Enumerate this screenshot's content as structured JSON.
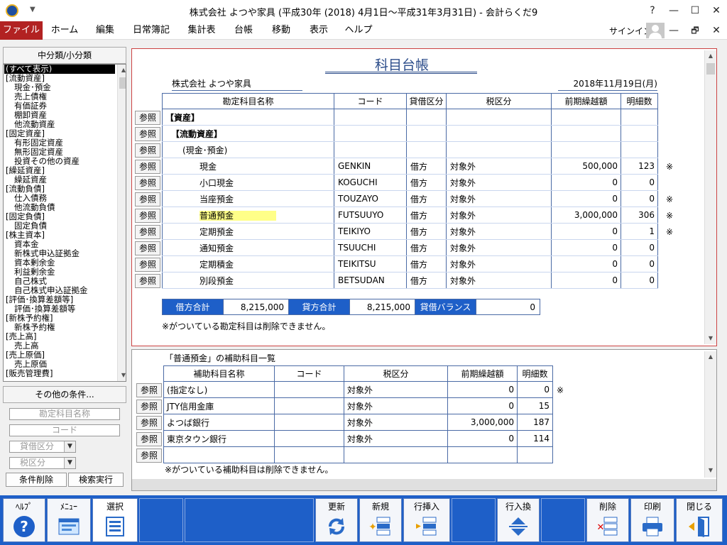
{
  "window": {
    "title": "株式会社 よつや家具 (平成30年 (2018) 4月1日～平成31年3月31日) - 会計らくだ9",
    "help": "?",
    "minimize": "—",
    "maximize": "☐",
    "close": "✕",
    "ribbon_min": "—",
    "ribbon_restore": "🗗",
    "ribbon_close": "✕"
  },
  "menu": {
    "items": [
      "ファイル",
      "ホーム",
      "編集",
      "日常簿記",
      "集計表",
      "台帳",
      "移動",
      "表示",
      "ヘルプ"
    ],
    "signin": "サインイン"
  },
  "left": {
    "header": "中分類/小分類",
    "categories": [
      "(すべて表示)",
      "[流動資産]",
      "現金･預金",
      "売上債権",
      "有価証券",
      "棚卸資産",
      "他流動資産",
      "[固定資産]",
      "有形固定資産",
      "無形固定資産",
      "投資その他の資産",
      "[繰延資産]",
      "繰延資産",
      "[流動負債]",
      "仕入債務",
      "他流動負債",
      "[固定負債]",
      "固定負債",
      "[株主資本]",
      "資本金",
      "新株式申込証拠金",
      "資本剰余金",
      "利益剰余金",
      "自己株式",
      "自己株式申込証拠金",
      "[評価･換算差額等]",
      "評価･換算差額等",
      "[新株予約権]",
      "新株予約権",
      "[売上高]",
      "売上高",
      "[売上原価]",
      "売上原価",
      "[販売管理費]"
    ],
    "other_conditions": "その他の条件...",
    "account_name_placeholder": "勘定科目名称",
    "code_placeholder": "コード",
    "debit_credit_placeholder": "貸借区分",
    "tax_placeholder": "税区分",
    "clear_button": "条件削除",
    "search_button": "検索実行"
  },
  "ledger": {
    "title": "科目台帳",
    "company": "株式会社 よつや家具",
    "date": "2018年11月19日(月)",
    "columns": [
      "勘定科目名称",
      "コード",
      "貸借区分",
      "税区分",
      "前期繰越額",
      "明細数"
    ],
    "ref_label": "参照",
    "rows": [
      {
        "name": "【資産】",
        "code": "",
        "dc": "",
        "tax": "",
        "balance": "",
        "count": "",
        "mark": ""
      },
      {
        "name": "【流動資産】",
        "code": "",
        "dc": "",
        "tax": "",
        "balance": "",
        "count": "",
        "mark": ""
      },
      {
        "name": "(現金･預金)",
        "code": "",
        "dc": "",
        "tax": "",
        "balance": "",
        "count": "",
        "mark": ""
      },
      {
        "name": "現金",
        "code": "GENKIN",
        "dc": "借方",
        "tax": "対象外",
        "balance": "500,000",
        "count": "123",
        "mark": "※"
      },
      {
        "name": "小口現金",
        "code": "KOGUCHI",
        "dc": "借方",
        "tax": "対象外",
        "balance": "0",
        "count": "0",
        "mark": ""
      },
      {
        "name": "当座預金",
        "code": "TOUZAYO",
        "dc": "借方",
        "tax": "対象外",
        "balance": "0",
        "count": "0",
        "mark": "※"
      },
      {
        "name": "普通預金",
        "code": "FUTSUUYO",
        "dc": "借方",
        "tax": "対象外",
        "balance": "3,000,000",
        "count": "306",
        "mark": "※"
      },
      {
        "name": "定期預金",
        "code": "TEIKIYO",
        "dc": "借方",
        "tax": "対象外",
        "balance": "0",
        "count": "1",
        "mark": "※"
      },
      {
        "name": "通知預金",
        "code": "TSUUCHI",
        "dc": "借方",
        "tax": "対象外",
        "balance": "0",
        "count": "0",
        "mark": ""
      },
      {
        "name": "定期積金",
        "code": "TEIKITSU",
        "dc": "借方",
        "tax": "対象外",
        "balance": "0",
        "count": "0",
        "mark": ""
      },
      {
        "name": "別段預金",
        "code": "BETSUDAN",
        "dc": "借方",
        "tax": "対象外",
        "balance": "0",
        "count": "0",
        "mark": ""
      }
    ],
    "totals": {
      "debit_label": "借方合計",
      "debit_value": "8,215,000",
      "credit_label": "貸方合計",
      "credit_value": "8,215,000",
      "balance_label": "貸借バランス",
      "balance_value": "0"
    },
    "note": "※がついている勘定科目は削除できません。"
  },
  "sub": {
    "title": "「普通預金」の補助科目一覧",
    "columns": [
      "補助科目名称",
      "コード",
      "税区分",
      "前期繰越額",
      "明細数"
    ],
    "rows": [
      {
        "name": "(指定なし)",
        "code": "",
        "tax": "対象外",
        "balance": "0",
        "count": "0",
        "mark": "※"
      },
      {
        "name": "JTY信用金庫",
        "code": "",
        "tax": "対象外",
        "balance": "0",
        "count": "15",
        "mark": ""
      },
      {
        "name": "よつば銀行",
        "code": "",
        "tax": "対象外",
        "balance": "3,000,000",
        "count": "187",
        "mark": ""
      },
      {
        "name": "東京タウン銀行",
        "code": "",
        "tax": "対象外",
        "balance": "0",
        "count": "114",
        "mark": ""
      },
      {
        "name": "",
        "code": "",
        "tax": "",
        "balance": "",
        "count": "",
        "mark": ""
      }
    ],
    "note": "※がついている補助科目は削除できません。"
  },
  "toolbar": {
    "help": "ﾍﾙﾌﾟ",
    "menu": "ﾒﾆｭｰ",
    "select": "選択",
    "refresh": "更新",
    "new": "新規",
    "insert_row": "行挿入",
    "swap_row": "行入換",
    "delete": "削除",
    "print": "印刷",
    "close": "閉じる"
  },
  "colors": {
    "accent": "#1e5fc8",
    "file_menu": "#b22222",
    "highlight": "#ffff88"
  }
}
